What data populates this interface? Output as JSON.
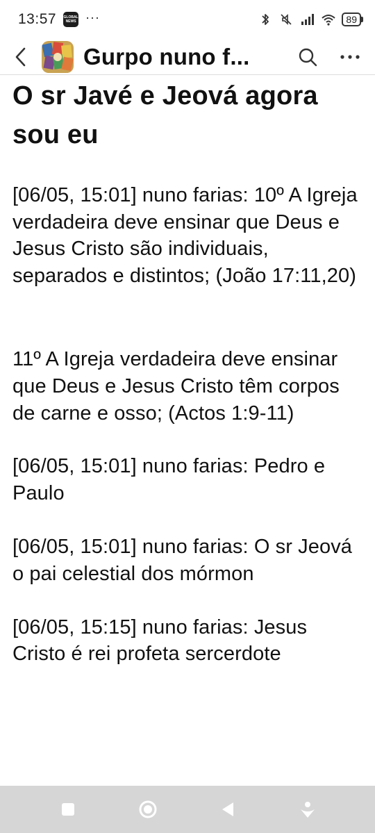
{
  "status_bar": {
    "time": "13:57",
    "news_badge_line1": "GLOBAL",
    "news_badge_line2": "NEWS",
    "more_dots": "···",
    "battery": "89",
    "icons": [
      "bluetooth-icon",
      "muted-icon",
      "signal-icon",
      "wifi-icon",
      "battery-icon"
    ]
  },
  "header": {
    "title": "Gurpo nuno f...",
    "icons": [
      "back-arrow-icon",
      "group-avatar",
      "search-icon",
      "more-icon"
    ]
  },
  "content": {
    "title": "O sr Javé e Jeová agora sou eu",
    "paragraphs": [
      "[06/05, 15:01] nuno farias: 10º A Igreja verdadeira deve ensinar que Deus e Jesus Cristo são individuais, separados e distintos; (João 17:11,20)",
      "11º A Igreja verdadeira deve ensinar que Deus e Jesus Cristo têm corpos de carne e osso; (Actos 1:9-11)",
      "[06/05, 15:01] nuno farias: Pedro e Paulo",
      "[06/05, 15:01] nuno farias: O sr Jeová o pai celestial dos mórmon",
      "[06/05, 15:15] nuno farias: Jesus Cristo é rei profeta sercerdote"
    ]
  },
  "nav_bar": {
    "icons": [
      "recents-icon",
      "home-icon",
      "back-icon",
      "assistant-icon"
    ],
    "background": "#d6d6d6"
  }
}
